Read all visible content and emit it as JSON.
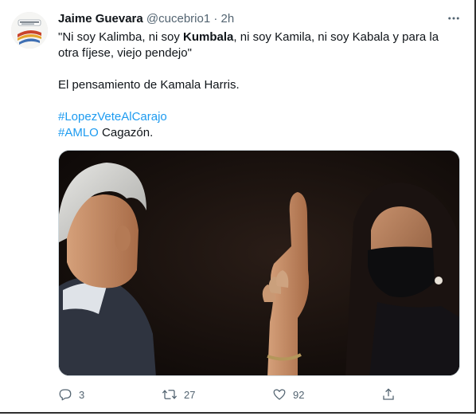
{
  "tweet": {
    "author": {
      "display_name": "Jaime Guevara",
      "handle": "@cucebrio1",
      "separator": "·",
      "timestamp": "2h",
      "avatar_icon": "avatar-logo-icon"
    },
    "text": {
      "line1_pre": "\"Ni soy Kalimba, ni soy ",
      "line1_bold": "Kumbala",
      "line1_post": ", ni soy Kamila, ni soy Kabala y para la otra fíjese, viejo pendejo\"",
      "paragraph2": "El pensamiento de Kamala Harris.",
      "hashtag1": "#LopezVeteAlCarajo",
      "hashtag2": "#AMLO",
      "hashtag2_suffix": " Cagazón."
    },
    "actions": {
      "replies": "3",
      "retweets": "27",
      "likes": "92"
    },
    "icons": {
      "more": "more-icon",
      "reply": "reply-icon",
      "retweet": "retweet-icon",
      "like": "heart-icon",
      "share": "share-icon"
    },
    "colors": {
      "link": "#1d9bf0",
      "muted": "#536471",
      "text": "#0f1419"
    }
  }
}
